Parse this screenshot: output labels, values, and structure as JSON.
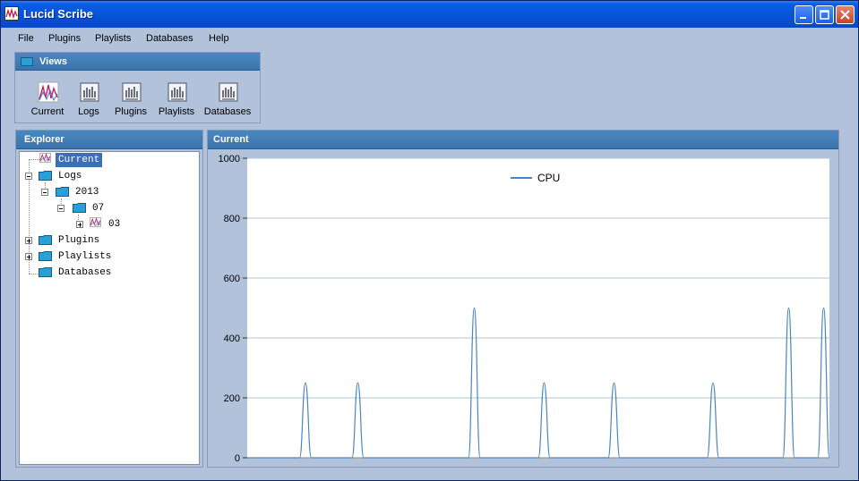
{
  "window": {
    "title": "Lucid Scribe"
  },
  "menu": [
    "File",
    "Plugins",
    "Playlists",
    "Databases",
    "Help"
  ],
  "views": {
    "header": "Views",
    "items": [
      {
        "label": "Current",
        "icon": "waveform-icon"
      },
      {
        "label": "Logs",
        "icon": "log-document-icon"
      },
      {
        "label": "Plugins",
        "icon": "plugin-document-icon"
      },
      {
        "label": "Playlists",
        "icon": "playlist-document-icon"
      },
      {
        "label": "Databases",
        "icon": "database-document-icon"
      }
    ]
  },
  "explorer": {
    "header": "Explorer",
    "tree": [
      {
        "label": "Current",
        "selected": true
      },
      {
        "label": "Logs"
      },
      {
        "label": "2013"
      },
      {
        "label": "07"
      },
      {
        "label": "03"
      },
      {
        "label": "Plugins"
      },
      {
        "label": "Playlists"
      },
      {
        "label": "Databases"
      }
    ]
  },
  "current_panel": {
    "header": "Current"
  },
  "chart_data": {
    "type": "line",
    "ylim": [
      0,
      1000
    ],
    "yticks": [
      "1000",
      "800",
      "600",
      "400",
      "200",
      "0"
    ],
    "legend": "top-center",
    "grid": true,
    "colors": {
      "line": "#4a86c0",
      "grid": "#b4c4d4"
    },
    "series": [
      {
        "name": "CPU",
        "x": [
          0,
          9,
          10,
          11,
          18,
          19,
          20,
          38,
          39,
          40,
          50,
          51,
          52,
          62,
          63,
          64,
          79,
          80,
          81,
          92,
          93,
          94,
          98,
          99,
          100
        ],
        "values": [
          0,
          0,
          250,
          0,
          0,
          250,
          0,
          0,
          500,
          0,
          0,
          250,
          0,
          0,
          250,
          0,
          0,
          250,
          0,
          0,
          500,
          0,
          0,
          500,
          0
        ]
      }
    ]
  }
}
